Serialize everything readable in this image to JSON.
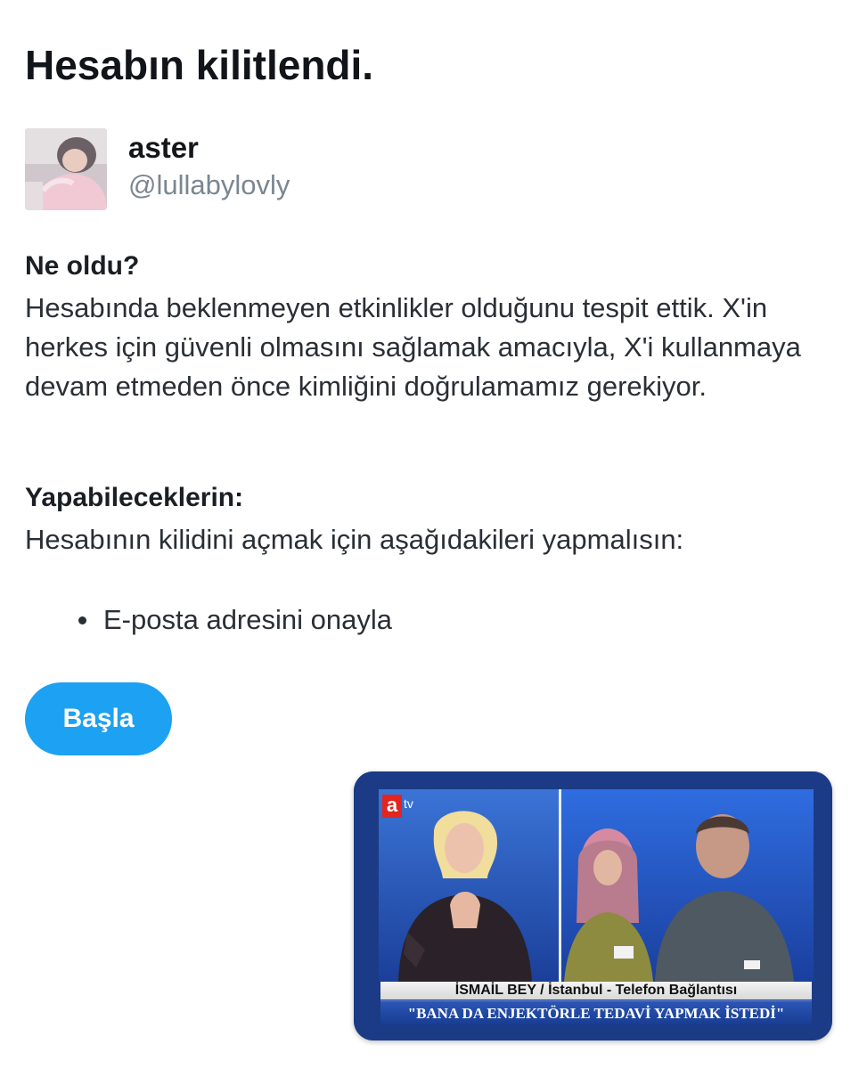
{
  "page": {
    "title": "Hesabın kilitlendi."
  },
  "profile": {
    "display_name": "aster",
    "handle": "@lullabylovly",
    "avatar_icon": "user-avatar-photo"
  },
  "what_happened": {
    "heading": "Ne oldu?",
    "body": "Hesabında beklenmeyen etkinlikler olduğunu tespit ettik. X'in herkes için güvenli olmasını sağlamak amacıyla, X'i kullanmaya devam etmeden önce kimliğini doğrulamamız gerekiyor."
  },
  "what_you_can_do": {
    "heading": "Yapabileceklerin:",
    "body": "Hesabının kilidini açmak için aşağıdakileri yapmalısın:",
    "steps": [
      {
        "label": "E-posta adresini onayla"
      }
    ]
  },
  "actions": {
    "start_label": "Başla"
  },
  "tv_image": {
    "channel_logo_letter": "a",
    "channel_logo_suffix": "tv",
    "caption": "İSMAİL BEY / İstanbul - Telefon Bağlantısı",
    "quote": "\"BANA DA ENJEKTÖRLE TEDAVİ YAPMAK İSTEDİ\""
  },
  "colors": {
    "accent_button": "#1da1f2",
    "handle_gray": "#7b8691",
    "tv_blue": "#1b3b86"
  }
}
